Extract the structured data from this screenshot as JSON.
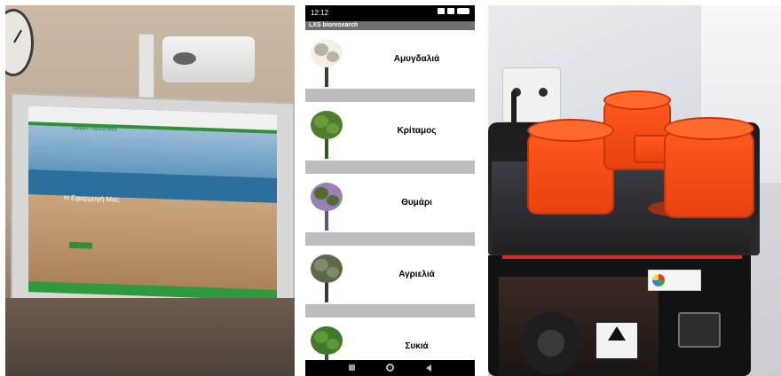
{
  "phone": {
    "status_time": "12:12",
    "app_title": "LXS bioresearch",
    "plants": [
      {
        "name": "Αμυγδαλιά",
        "icon": "almond-tree-photo"
      },
      {
        "name": "Κρίταμος",
        "icon": "rock-samphire-photo"
      },
      {
        "name": "Θυμάρι",
        "icon": "thyme-photo"
      },
      {
        "name": "Αγριελιά",
        "icon": "wild-olive-photo"
      },
      {
        "name": "Συκιά",
        "icon": "fig-tree-photo"
      }
    ]
  },
  "projection": {
    "brand": "GREEN TREASURES",
    "hero_title": "Η Εφαρμογή Μας",
    "accent_color": "#2f8f3a"
  },
  "printer": {
    "print_color": "#ff5a1f"
  }
}
